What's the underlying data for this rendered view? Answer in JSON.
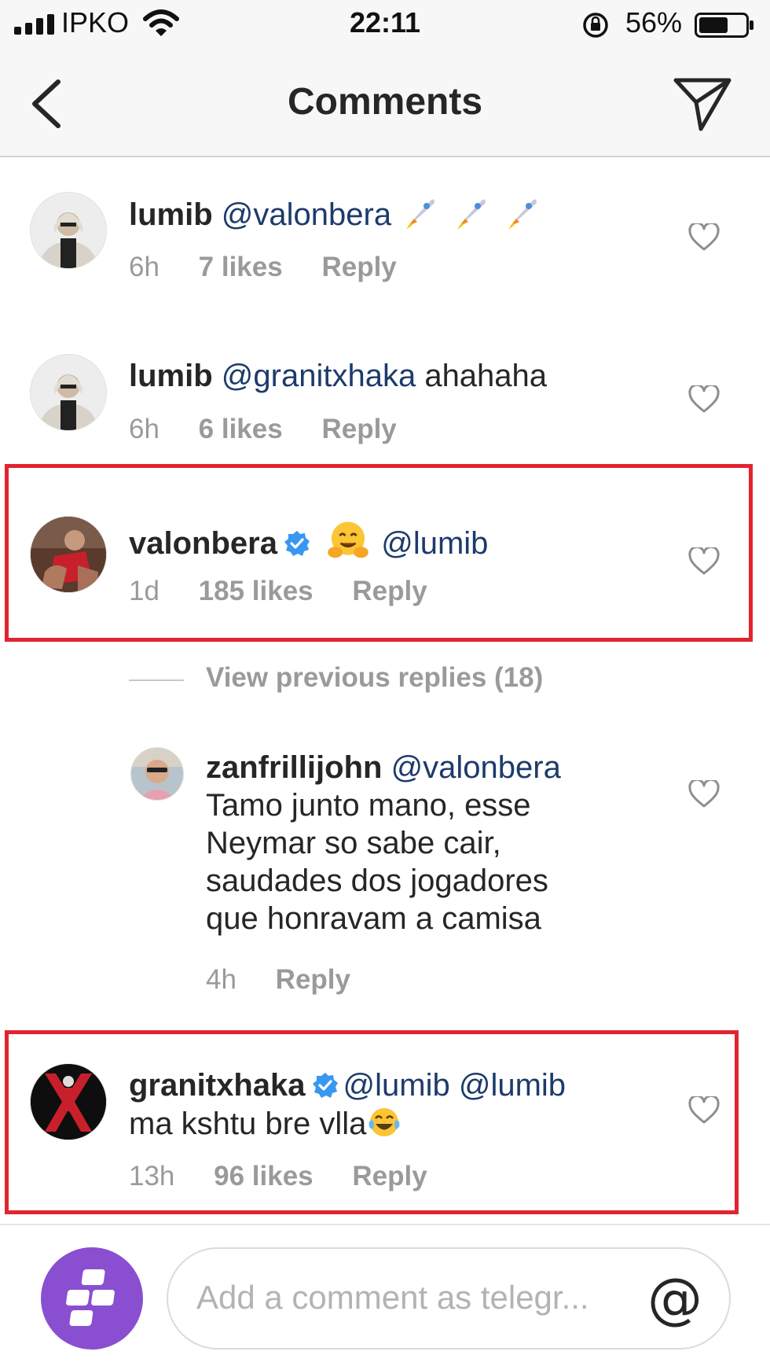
{
  "status_bar": {
    "carrier": "IPKO",
    "time": "22:11",
    "battery": "56%"
  },
  "nav": {
    "title": "Comments"
  },
  "comments": [
    {
      "user": "lumib",
      "mention": "@valonbera",
      "text": "",
      "time": "6h",
      "likes": "7 likes",
      "reply": "Reply",
      "emoji": "rocket x3"
    },
    {
      "user": "lumib",
      "mention": "@granitxhaka",
      "text": " ahahaha",
      "time": "6h",
      "likes": "6 likes",
      "reply": "Reply"
    },
    {
      "user": "valonbera",
      "verified": true,
      "emoji": "hugging-face",
      "mention": "@lumib",
      "time": "1d",
      "likes": "185 likes",
      "reply": "Reply"
    }
  ],
  "view_previous": "View previous replies (18)",
  "reply_comment": {
    "user": "zanfrillijohn",
    "mention": "@valonbera",
    "line1": "Tamo junto mano, esse",
    "line2": "Neymar so sabe cair,",
    "line3": "saudades dos jogadores",
    "line4": "que honravam a camisa",
    "time": "4h",
    "reply": "Reply"
  },
  "last_comment": {
    "user": "granitxhaka",
    "verified": true,
    "mention1": "@lumib",
    "mention2": "@lumib",
    "line2": "ma kshtu bre vlla",
    "emoji": "tears-of-joy",
    "time": "13h",
    "likes": "96 likes",
    "reply": "Reply"
  },
  "input": {
    "placeholder": "Add a comment as telegr...",
    "at_symbol": "@"
  },
  "colors": {
    "highlight": "#e1242f",
    "mention": "#1d3b6b",
    "verified": "#3897f0",
    "meta": "#9a9a9a",
    "composer_avatar": "#8a4fd0"
  }
}
